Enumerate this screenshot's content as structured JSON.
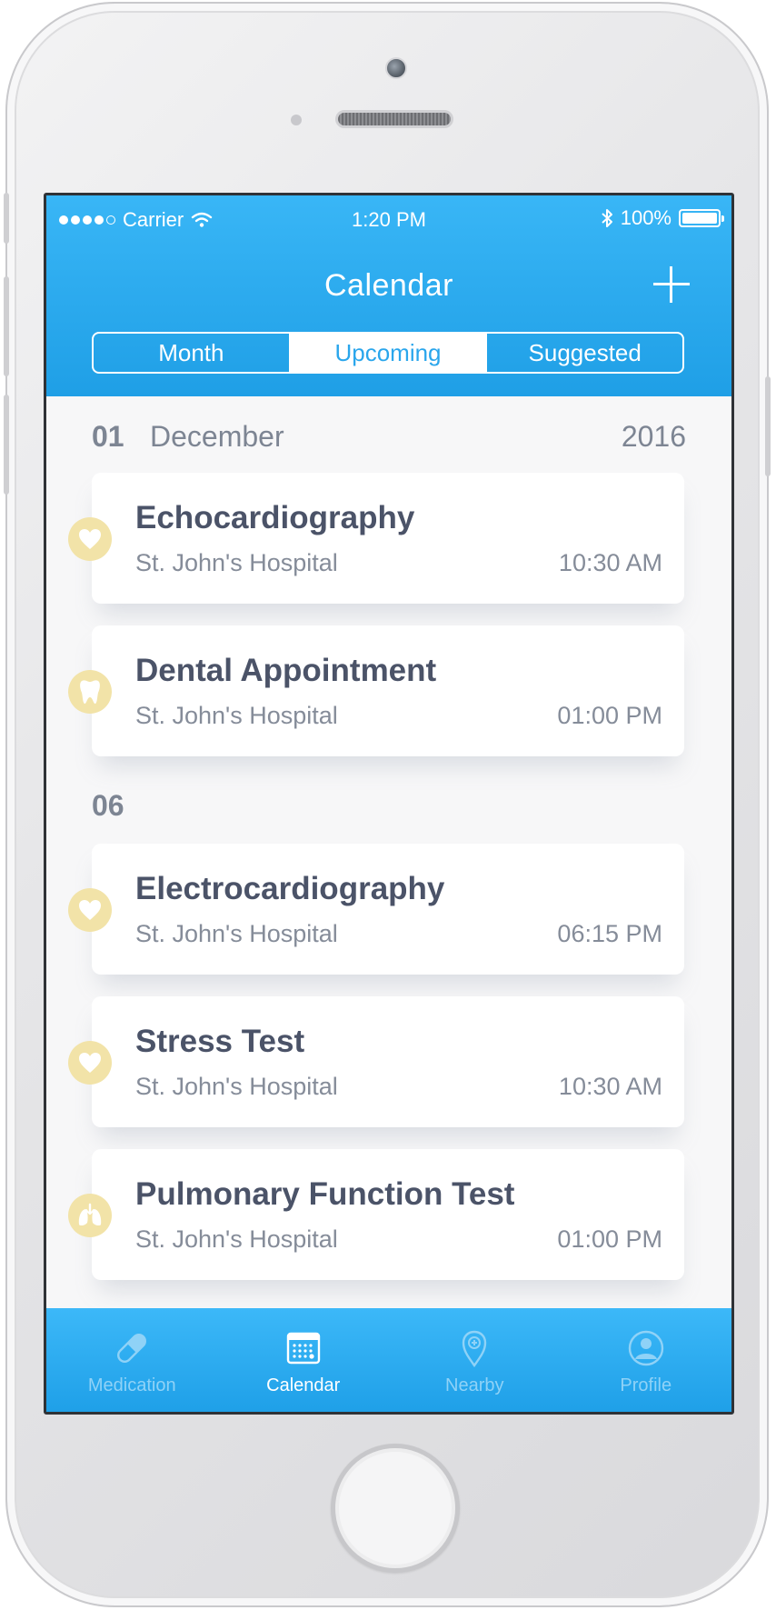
{
  "status": {
    "carrier": "Carrier",
    "time": "1:20 PM",
    "battery": "100%"
  },
  "nav": {
    "title": "Calendar",
    "segments": [
      "Month",
      "Upcoming",
      "Suggested"
    ],
    "active_segment": "Upcoming"
  },
  "groups": [
    {
      "day": "01",
      "month": "December",
      "year": "2016",
      "items": [
        {
          "title": "Echocardiography",
          "place": "St. John's Hospital",
          "time": "10:30 AM",
          "icon": "heart-icon"
        },
        {
          "title": "Dental Appointment",
          "place": "St. John's Hospital",
          "time": "01:00 PM",
          "icon": "tooth-icon"
        }
      ]
    },
    {
      "day": "06",
      "month": "",
      "year": "",
      "items": [
        {
          "title": "Electrocardiography",
          "place": "St. John's Hospital",
          "time": "06:15 PM",
          "icon": "heart-icon"
        },
        {
          "title": "Stress Test",
          "place": "St. John's Hospital",
          "time": "10:30 AM",
          "icon": "heart-icon"
        },
        {
          "title": "Pulmonary Function Test",
          "place": "St. John's Hospital",
          "time": "01:00 PM",
          "icon": "lungs-icon"
        }
      ]
    }
  ],
  "tabbar": {
    "items": [
      {
        "label": "Medication",
        "icon": "pill-icon"
      },
      {
        "label": "Calendar",
        "icon": "calendar-icon"
      },
      {
        "label": "Nearby",
        "icon": "location-pin-icon"
      },
      {
        "label": "Profile",
        "icon": "profile-icon"
      }
    ],
    "active": "Calendar"
  },
  "colors": {
    "accent_blue": "#29a9ee",
    "icon_badge": "#f2e3a8",
    "title_text": "#4b5368",
    "secondary_text": "#858c99"
  }
}
